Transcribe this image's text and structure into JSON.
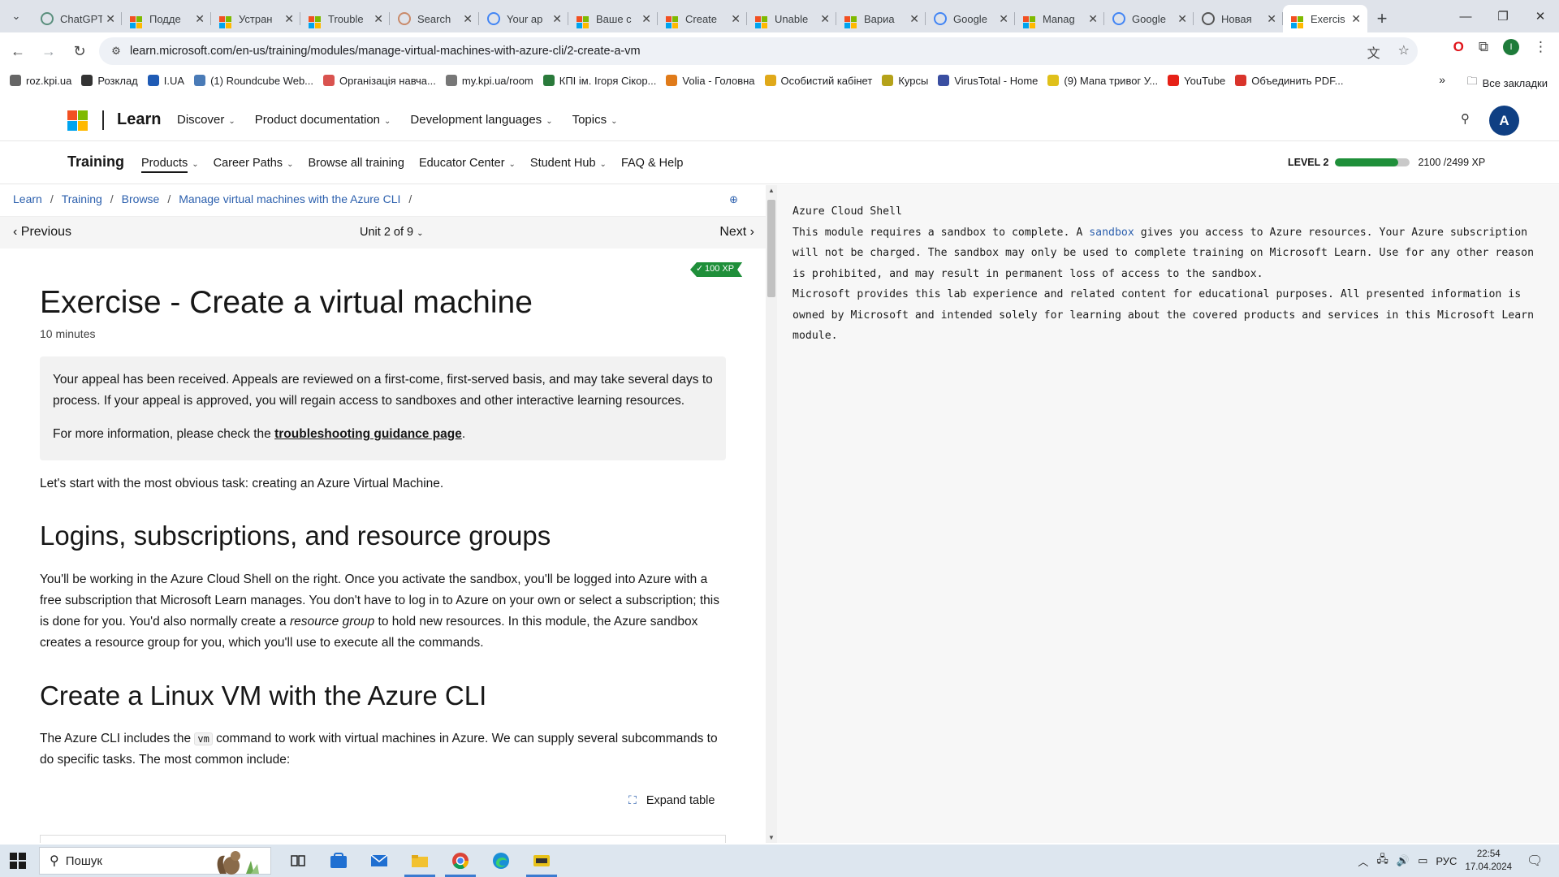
{
  "browser": {
    "tabs": [
      {
        "title": "ChatGPT",
        "favicon": "chatgpt-icon",
        "color": "#5a8f7d",
        "active": false
      },
      {
        "title": "Подде",
        "favicon": "microsoft-icon",
        "color": "#f25022",
        "active": false
      },
      {
        "title": "Устран",
        "favicon": "microsoft-icon",
        "color": "#f25022",
        "active": false
      },
      {
        "title": "Trouble",
        "favicon": "microsoft-icon",
        "color": "#f25022",
        "active": false
      },
      {
        "title": "Search",
        "favicon": "search-tab-icon",
        "color": "#c98a6a",
        "active": false
      },
      {
        "title": "Your ap",
        "favicon": "google-icon",
        "color": "#4285f4",
        "active": false
      },
      {
        "title": "Ваше с",
        "favicon": "microsoft-icon",
        "color": "#f25022",
        "active": false
      },
      {
        "title": "Create",
        "favicon": "microsoft-icon",
        "color": "#f25022",
        "active": false
      },
      {
        "title": "Unable",
        "favicon": "microsoft-icon",
        "color": "#f25022",
        "active": false
      },
      {
        "title": "Вариа",
        "favicon": "microsoft-icon",
        "color": "#f25022",
        "active": false
      },
      {
        "title": "Google",
        "favicon": "google-translate-icon",
        "color": "#4285f4",
        "active": false
      },
      {
        "title": "Manag",
        "favicon": "microsoft-icon",
        "color": "#f25022",
        "active": false
      },
      {
        "title": "Google",
        "favicon": "google-translate-icon",
        "color": "#4285f4",
        "active": false
      },
      {
        "title": "Новая",
        "favicon": "chrome-icon",
        "color": "#555555",
        "active": false
      },
      {
        "title": "Exercis",
        "favicon": "microsoft-icon",
        "color": "#f25022",
        "active": true
      }
    ],
    "url": "learn.microsoft.com/en-us/training/modules/manage-virtual-machines-with-azure-cli/2-create-a-vm",
    "profile_initial": "I",
    "bookmarks": [
      {
        "label": "roz.kpi.ua",
        "color": "#666666"
      },
      {
        "label": "Розклад",
        "color": "#333333"
      },
      {
        "label": "I.UA",
        "color": "#1f5bb5"
      },
      {
        "label": "(1) Roundcube Web...",
        "color": "#4a7bb7"
      },
      {
        "label": "Організація навча...",
        "color": "#d9534f"
      },
      {
        "label": "my.kpi.ua/room",
        "color": "#777777"
      },
      {
        "label": "КПІ ім. Ігоря Сікор...",
        "color": "#2a7a3b"
      },
      {
        "label": "Volia - Головна",
        "color": "#e07b1a"
      },
      {
        "label": "Особистий кабінет",
        "color": "#e0a91a"
      },
      {
        "label": "Курсы",
        "color": "#b5a21a"
      },
      {
        "label": "VirusTotal - Home",
        "color": "#3a4ea1"
      },
      {
        "label": "(9) Мапа тривог У...",
        "color": "#e0c01a"
      },
      {
        "label": "YouTube",
        "color": "#e62117"
      },
      {
        "label": "Объединить PDF...",
        "color": "#d9342b"
      }
    ],
    "all_bookmarks": "Все закладки"
  },
  "header": {
    "brand": "Learn",
    "menu": [
      "Discover",
      "Product documentation",
      "Development languages",
      "Topics"
    ],
    "avatar": "A"
  },
  "training_nav": {
    "title": "Training",
    "menu": [
      {
        "label": "Products",
        "dropdown": true,
        "active": true
      },
      {
        "label": "Career Paths",
        "dropdown": true,
        "active": false
      },
      {
        "label": "Browse all training",
        "dropdown": false,
        "active": false
      },
      {
        "label": "Educator Center",
        "dropdown": true,
        "active": false
      },
      {
        "label": "Student Hub",
        "dropdown": true,
        "active": false
      },
      {
        "label": "FAQ & Help",
        "dropdown": false,
        "active": false
      }
    ],
    "level": "LEVEL 2",
    "xp_progress": 0.84,
    "xp": "2100 /2499 XP"
  },
  "breadcrumb": [
    "Learn",
    "Training",
    "Browse",
    "Manage virtual machines with the Azure CLI"
  ],
  "unit_nav": {
    "previous": "Previous",
    "unit": "Unit 2 of 9",
    "next": "Next"
  },
  "content": {
    "xp_badge": "100 XP",
    "title": "Exercise - Create a virtual machine",
    "duration": "10 minutes",
    "notice_p1": "Your appeal has been received. Appeals are reviewed on a first-come, first-served basis, and may take several days to process. If your appeal is approved, you will regain access to sandboxes and other interactive learning resources.",
    "notice_p2_pre": "For more information, please check the ",
    "notice_link": "troubleshooting guidance page",
    "notice_p2_post": ".",
    "intro": "Let's start with the most obvious task: creating an Azure Virtual Machine.",
    "h2_1": "Logins, subscriptions, and resource groups",
    "para1_a": "You'll be working in the Azure Cloud Shell on the right. Once you activate the sandbox, you'll be logged into Azure with a free subscription that Microsoft Learn manages. You don't have to log in to Azure on your own or select a subscription; this is done for you. You'd also normally create a ",
    "para1_em": "resource group",
    "para1_b": " to hold new resources. In this module, the Azure sandbox creates a resource group for you, which you'll use to execute all the commands.",
    "h2_2": "Create a Linux VM with the Azure CLI",
    "para2_a": "The Azure CLI includes the ",
    "para2_code": "vm",
    "para2_b": " command to work with virtual machines in Azure. We can supply several subcommands to do specific tasks. The most common include:",
    "expand_table": "Expand table"
  },
  "shell": {
    "title": "Azure Cloud Shell",
    "line1_pre": "This module requires a sandbox to complete. A ",
    "line1_link": "sandbox",
    "line1_post": " gives you access to Azure resources. Your Azure subscription will not be charged. The sandbox may only be used to complete training on Microsoft Learn. Use for any other reason is prohibited, and may result in permanent loss of access to the sandbox.",
    "line2": "Microsoft provides this lab experience and related content for educational purposes. All presented information is owned by Microsoft and intended solely for learning about the covered products and services in this Microsoft Learn module."
  },
  "taskbar": {
    "search_placeholder": "Пошук",
    "lang": "РУС",
    "time": "22:54",
    "date": "17.04.2024"
  }
}
